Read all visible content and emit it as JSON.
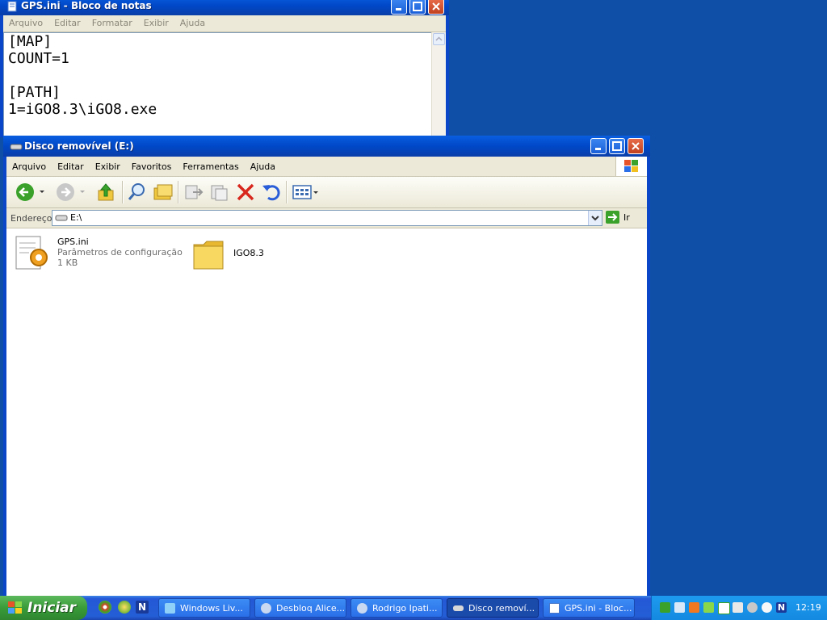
{
  "notepad": {
    "title": "GPS.ini - Bloco de notas",
    "menu": [
      "Arquivo",
      "Editar",
      "Formatar",
      "Exibir",
      "Ajuda"
    ],
    "lines": [
      "[MAP]",
      "COUNT=1",
      "",
      "[PATH]",
      "1=iGO8.3\\iGO8.exe"
    ]
  },
  "explorer": {
    "title": "Disco removível (E:)",
    "menu": [
      "Arquivo",
      "Editar",
      "Exibir",
      "Favoritos",
      "Ferramentas",
      "Ajuda"
    ],
    "address_label": "Endereço",
    "address_value": "E:\\",
    "go_label": "Ir",
    "items": [
      {
        "name": "GPS.ini",
        "type": "Parâmetros de configuração",
        "size": "1 KB",
        "icon": "ini-file-icon"
      },
      {
        "name": "IGO8.3",
        "icon": "folder-icon"
      }
    ]
  },
  "taskbar": {
    "start_label": "Iniciar",
    "tasks": [
      {
        "label": "Windows Liv...",
        "active": false
      },
      {
        "label": "Desbloq Alice...",
        "active": false
      },
      {
        "label": "Rodrigo Ipati...",
        "active": false
      },
      {
        "label": "Disco removí...",
        "active": true
      },
      {
        "label": "GPS.ini - Bloc...",
        "active": false
      }
    ],
    "clock": "12:19"
  },
  "colors": {
    "desktop": "#0f4fa8",
    "title_bar": "#0048c8",
    "taskbar": "#245ed6",
    "start": "#399b39"
  }
}
